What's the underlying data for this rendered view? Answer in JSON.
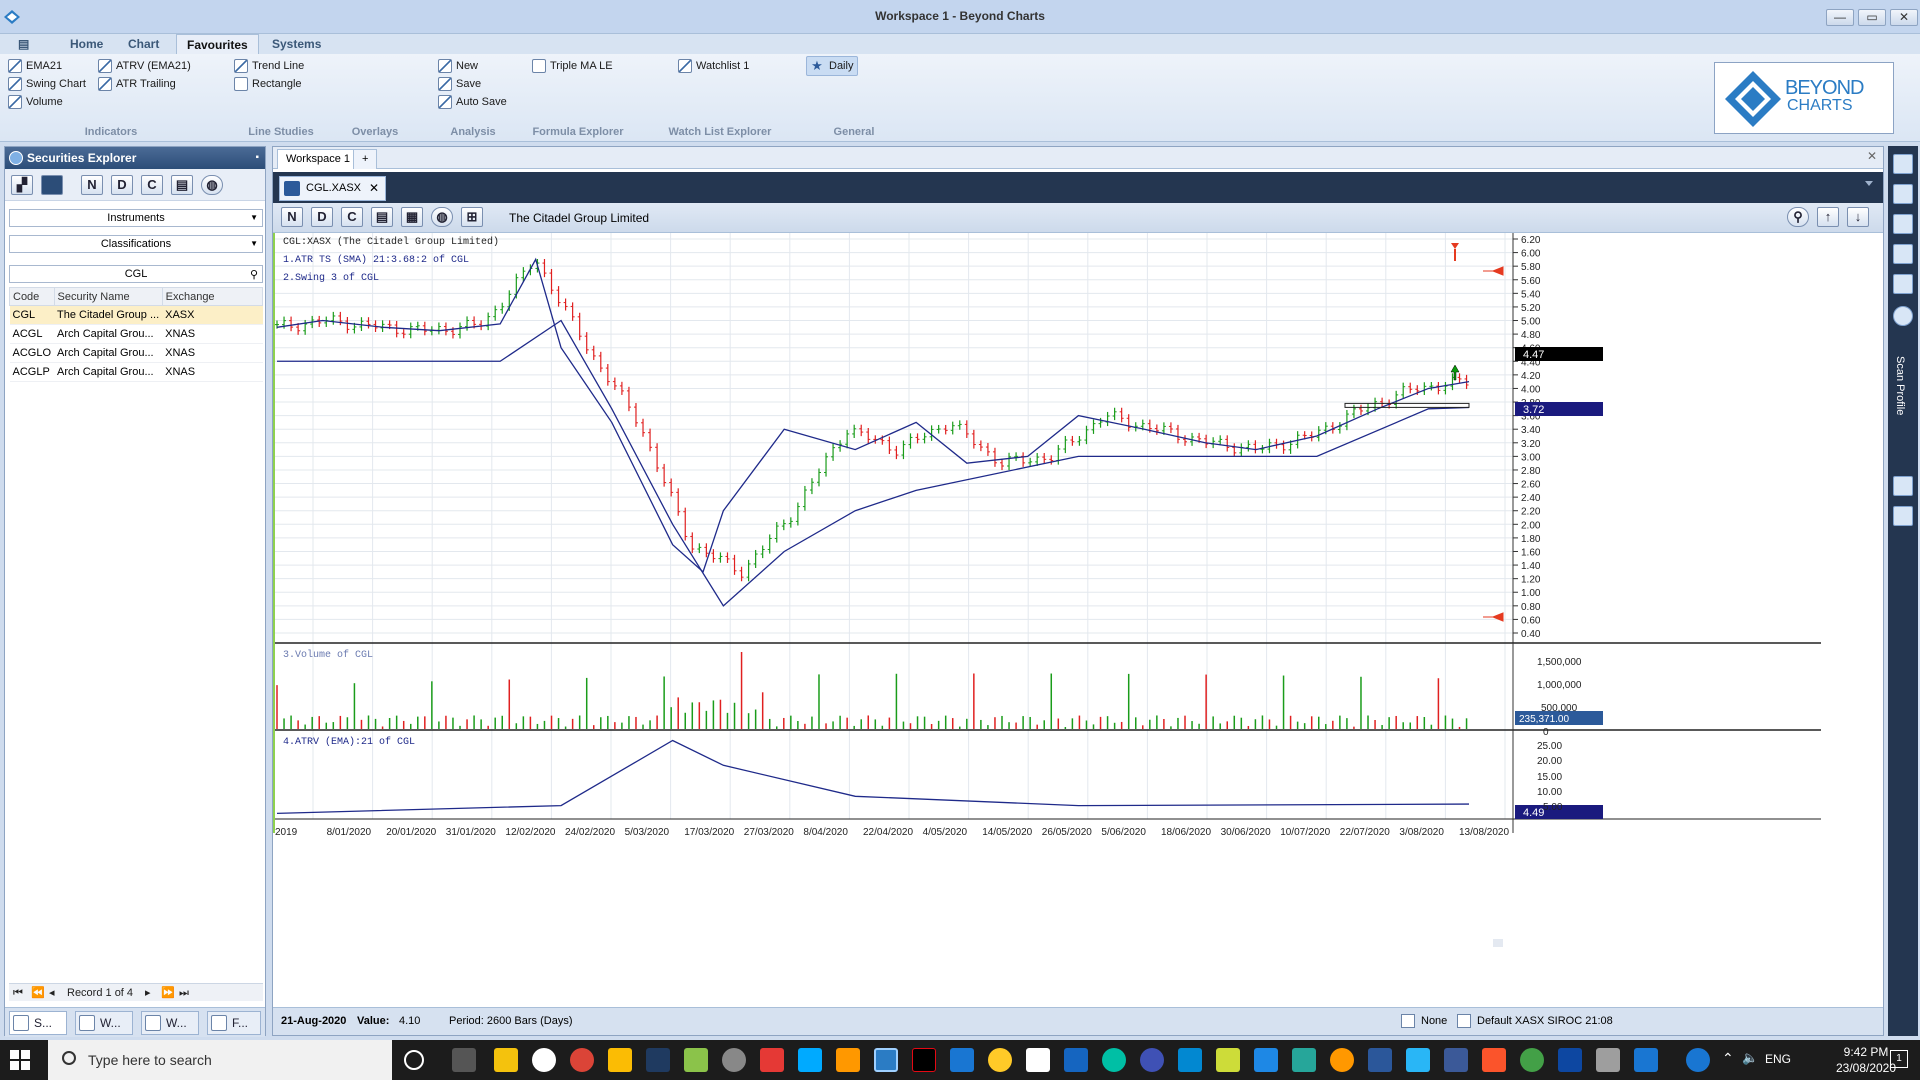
{
  "window": {
    "title": "Workspace 1 - Beyond Charts",
    "minimize": "—",
    "maximize": "▭",
    "close": "✕"
  },
  "ribbon": {
    "tabs": [
      {
        "label": "Home"
      },
      {
        "label": "Chart"
      },
      {
        "label": "Favourites"
      },
      {
        "label": "Systems"
      }
    ],
    "indicators": [
      "EMA21",
      "ATRV (EMA21)",
      "Swing Chart",
      "ATR Trailing",
      "Volume"
    ],
    "line_studies": [
      "Trend Line",
      "Rectangle"
    ],
    "analysis": [
      "New",
      "Save",
      "Auto Save"
    ],
    "formula": [
      "Triple MA LE"
    ],
    "watchlist": [
      "Watchlist 1"
    ],
    "general": [
      "Daily"
    ],
    "groups": [
      "Indicators",
      "Line Studies",
      "Overlays",
      "Analysis",
      "Formula Explorer",
      "Watch List Explorer",
      "General"
    ],
    "logo": {
      "line1": "BEYOND",
      "line2": "CHARTS"
    }
  },
  "securities": {
    "title": "Securities Explorer",
    "toolbar_letters": [
      "N",
      "D",
      "C"
    ],
    "instruments": "Instruments",
    "classifications": "Classifications",
    "search_value": "CGL",
    "columns": [
      "Code",
      "Security Name",
      "Exchange"
    ],
    "rows": [
      {
        "code": "CGL",
        "name": "The Citadel Group ...",
        "exchange": "XASX"
      },
      {
        "code": "ACGL",
        "name": "Arch Capital Grou...",
        "exchange": "XNAS"
      },
      {
        "code": "ACGLO",
        "name": "Arch Capital Grou...",
        "exchange": "XNAS"
      },
      {
        "code": "ACGLP",
        "name": "Arch Capital Grou...",
        "exchange": "XNAS"
      }
    ],
    "record_label": "Record 1 of 4",
    "bottom_tabs": [
      "S...",
      "W...",
      "W...",
      "F..."
    ]
  },
  "workspace": {
    "tab": "Workspace 1",
    "add": "+",
    "chart_tab": "CGL.XASX",
    "toolbar_letters": [
      "N",
      "D",
      "C"
    ],
    "security_name": "The Citadel Group Limited"
  },
  "chart": {
    "legend": [
      "CGL:XASX (The Citadel Group Limited)",
      "1.ATR TS (SMA) 21:3.68:2 of CGL",
      "2.Swing 3  of CGL"
    ],
    "volume_label": "3.Volume  of CGL",
    "atrv_label": "4.ATRV (EMA):21 of CGL",
    "last_price": "4.47",
    "stop_level": "3.72",
    "last_volume": "235,371.00",
    "last_atrv": "4.49",
    "volume_ticks": [
      "1,500,000",
      "1,000,000",
      "500,000"
    ],
    "atrv_ticks": [
      "25.00",
      "20.00",
      "15.00",
      "10.00",
      "5.00",
      "0"
    ],
    "date_labels": [
      "2019",
      "8/01/2020",
      "20/01/2020",
      "31/01/2020",
      "12/02/2020",
      "24/02/2020",
      "5/03/2020",
      "17/03/2020",
      "27/03/2020",
      "8/04/2020",
      "22/04/2020",
      "4/05/2020",
      "14/05/2020",
      "26/05/2020",
      "5/06/2020",
      "18/06/2020",
      "30/06/2020",
      "10/07/2020",
      "22/07/2020",
      "3/08/2020",
      "13/08/2020"
    ],
    "colors": {
      "up": "#1a9c1a",
      "down": "#e02020",
      "line": "#1f2a8a",
      "grid": "#e3e8ee"
    }
  },
  "chart_data": {
    "type": "line",
    "title": "CGL:XASX (The Citadel Group Limited)",
    "series": [
      {
        "name": "CGL",
        "x": [
          "2019-12-30",
          "2020-01-08",
          "2020-01-20",
          "2020-01-31",
          "2020-02-12",
          "2020-02-19",
          "2020-02-24",
          "2020-03-05",
          "2020-03-17",
          "2020-03-23",
          "2020-03-27",
          "2020-04-08",
          "2020-04-22",
          "2020-05-04",
          "2020-05-14",
          "2020-05-26",
          "2020-06-05",
          "2020-06-18",
          "2020-06-30",
          "2020-07-10",
          "2020-07-22",
          "2020-08-03",
          "2020-08-13",
          "2020-08-21"
        ],
        "values": [
          4.9,
          5.0,
          4.9,
          4.85,
          4.95,
          5.9,
          4.6,
          3.5,
          1.7,
          1.3,
          2.2,
          3.4,
          3.1,
          3.5,
          2.9,
          3.0,
          3.6,
          3.4,
          3.2,
          3.1,
          3.3,
          3.7,
          4.0,
          4.1
        ]
      },
      {
        "name": "ATR TS (SMA) 21:3.68:2",
        "x": [
          "2019-12-30",
          "2020-02-12",
          "2020-02-24",
          "2020-03-05",
          "2020-03-17",
          "2020-03-27",
          "2020-04-08",
          "2020-04-22",
          "2020-05-04",
          "2020-06-05",
          "2020-07-10",
          "2020-07-22",
          "2020-08-13",
          "2020-08-21"
        ],
        "values": [
          4.4,
          4.4,
          5.0,
          3.7,
          2.0,
          0.8,
          1.6,
          2.2,
          2.5,
          3.0,
          3.0,
          3.0,
          3.7,
          3.72
        ]
      },
      {
        "name": "Volume",
        "x": [
          "2020-03-17",
          "2020-06-05",
          "2020-08-13",
          "2020-08-21"
        ],
        "values": [
          1500000,
          1250000,
          1300000,
          235371
        ]
      },
      {
        "name": "ATRV (EMA):21",
        "x": [
          "2019-12-30",
          "2020-02-24",
          "2020-03-17",
          "2020-03-27",
          "2020-04-22",
          "2020-06-05",
          "2020-08-21"
        ],
        "values": [
          1.5,
          4,
          25,
          17,
          7,
          4,
          4.49
        ]
      }
    ],
    "ylim": [
      0.4,
      6.2
    ]
  },
  "status": {
    "date": "21-Aug-2020",
    "value_label": "Value:",
    "value": "4.10",
    "period": "Period: 2600 Bars (Days)",
    "none_label": "None",
    "default_label": "Default XASX SIROC 21:08"
  },
  "rail": {
    "label": "Scan Profile"
  },
  "taskbar": {
    "search": "Type here to search",
    "time": "9:42 PM",
    "date": "23/08/2020",
    "lang": "ENG"
  }
}
